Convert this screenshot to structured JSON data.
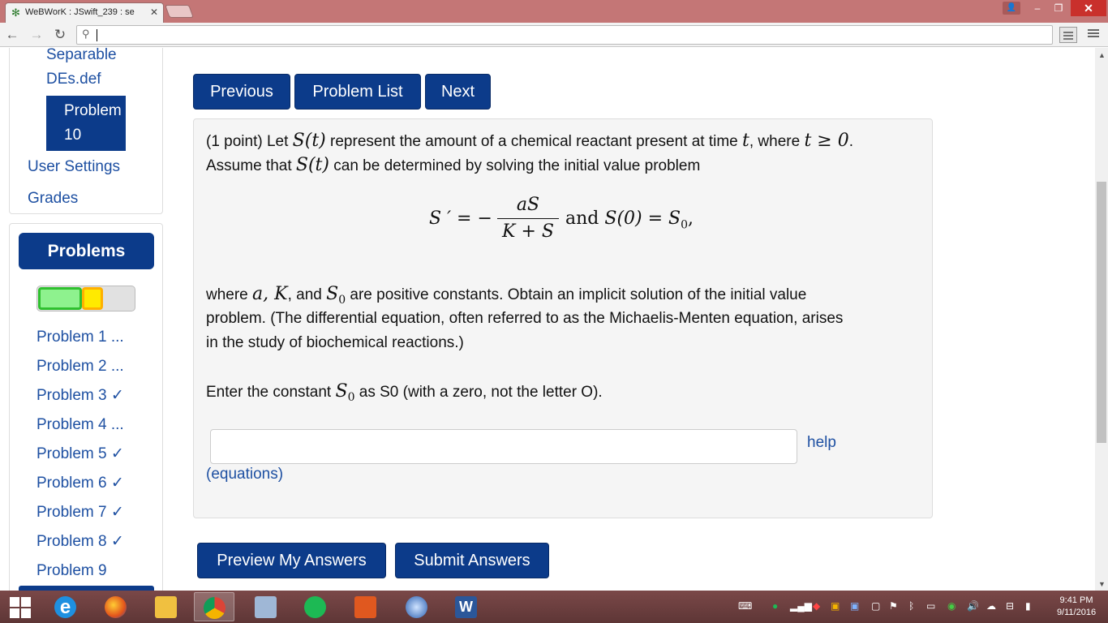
{
  "browser": {
    "tab_title": "WeBWorK : JSwift_239 : se",
    "url": ""
  },
  "sidebar": {
    "set_name_line1": "Separable",
    "set_name_line2": "DEs.def",
    "active_line1": "Problem",
    "active_line2": "10",
    "user_settings": "User Settings",
    "grades": "Grades",
    "problems_header": "Problems",
    "progress": {
      "correct_fraction": 0.45,
      "partial_fraction": 0.22
    },
    "problem_items": [
      "Problem 1 ...",
      "Problem 2 ...",
      "Problem 3 ✓",
      "Problem 4 ...",
      "Problem 5 ✓",
      "Problem 6 ✓",
      "Problem 7 ✓",
      "Problem 8 ✓",
      "Problem 9"
    ]
  },
  "nav": {
    "previous": "Previous",
    "problem_list": "Problem List",
    "next": "Next"
  },
  "problem": {
    "line1_a": "(1 point) Let ",
    "line1_St": "S(t)",
    "line1_b": " represent the amount of a chemical reactant present at time ",
    "line1_t": "t",
    "line1_c": ", where ",
    "line1_cond": "t ≥ 0",
    "line1_d": ".",
    "line2_a": "Assume that ",
    "line2_St": "S(t)",
    "line2_b": " can be determined by solving the initial value problem",
    "eq_lhs": "S ′ = −",
    "eq_num": "aS",
    "eq_den": "K + S",
    "eq_rhs_and": " and ",
    "eq_rhs_cond": "S(0) = S",
    "eq_rhs_sub": "0",
    "eq_rhs_end": ",",
    "line3_a": "where ",
    "line3_vars": "a, K",
    "line3_b": ", and ",
    "line3_S": "S",
    "line3_sub": "0",
    "line3_c": " are positive constants. Obtain an implicit solution of the initial value",
    "line4": "problem. (The differential equation, often referred to as the Michaelis-Menten equation, arises",
    "line5": "in the study of biochemical reactions.)",
    "line6_a": "Enter the constant ",
    "line6_S": "S",
    "line6_sub": "0",
    "line6_b": " as S0 (with a zero, not the letter O).",
    "answer_value": "",
    "help": "help",
    "equations": "(equations)"
  },
  "actions": {
    "preview": "Preview My Answers",
    "submit": "Submit Answers"
  },
  "taskbar": {
    "time": "9:41 PM",
    "date": "9/11/2016"
  }
}
